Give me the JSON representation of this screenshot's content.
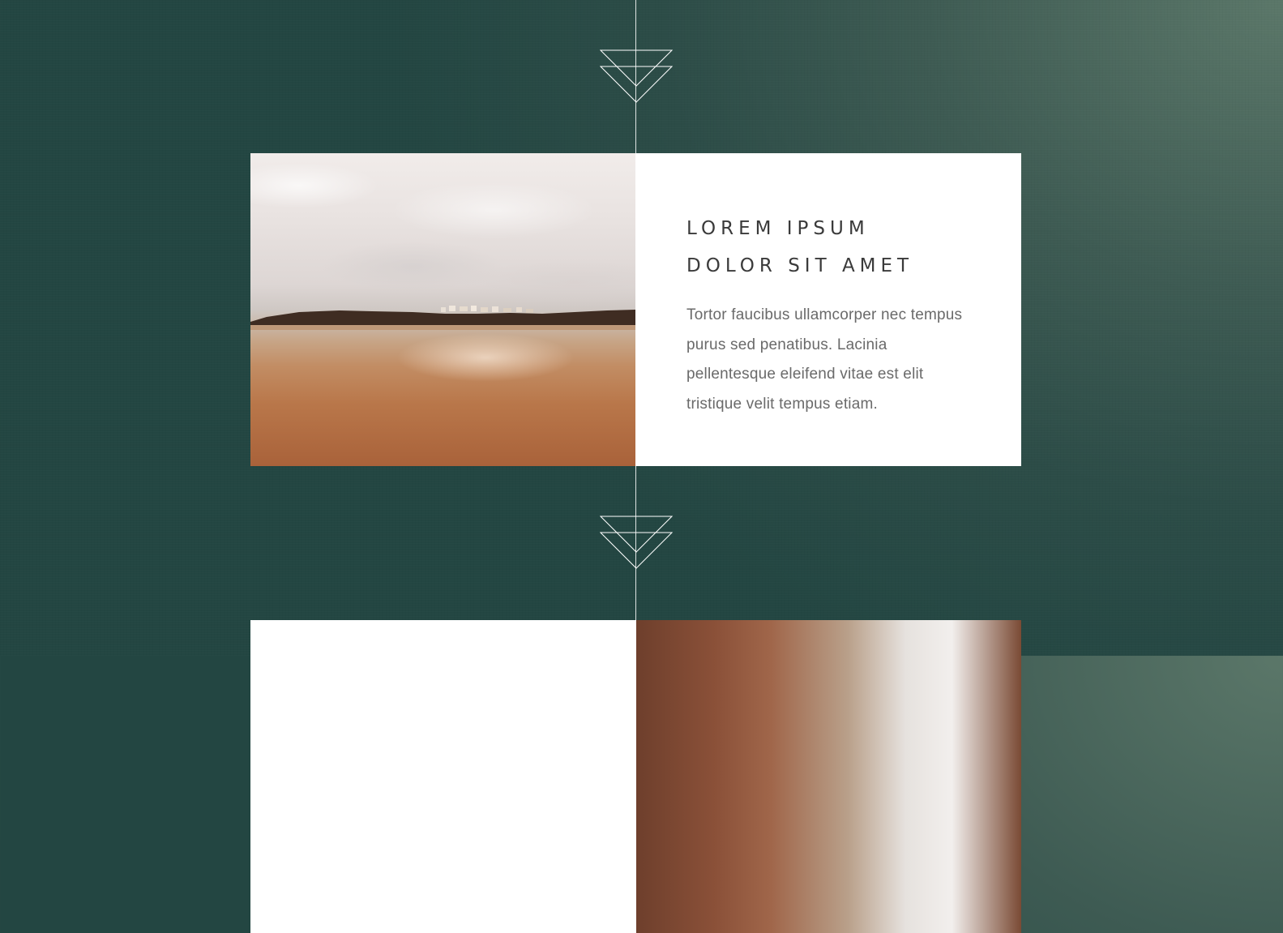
{
  "colors": {
    "background_dark": "#234642",
    "background_light": "#5b7769",
    "line": "#ffffff",
    "card_bg": "#ffffff",
    "heading_text": "#3a3a3a",
    "body_text": "#6a6a6a"
  },
  "icons": {
    "divider": "double-triangle-down-icon"
  },
  "timeline": {
    "items": [
      {
        "image": "beach-landscape-photo",
        "heading_line1": "LOREM IPSUM",
        "heading_line2": "DOLOR SIT AMET",
        "body": "Tortor faucibus ullamcorper nec tempus purus sed penatibus. Lacinia pellentesque eleifend vitae est elit tristique velit tempus etiam."
      },
      {
        "image": "brick-buildings-photo"
      }
    ]
  }
}
